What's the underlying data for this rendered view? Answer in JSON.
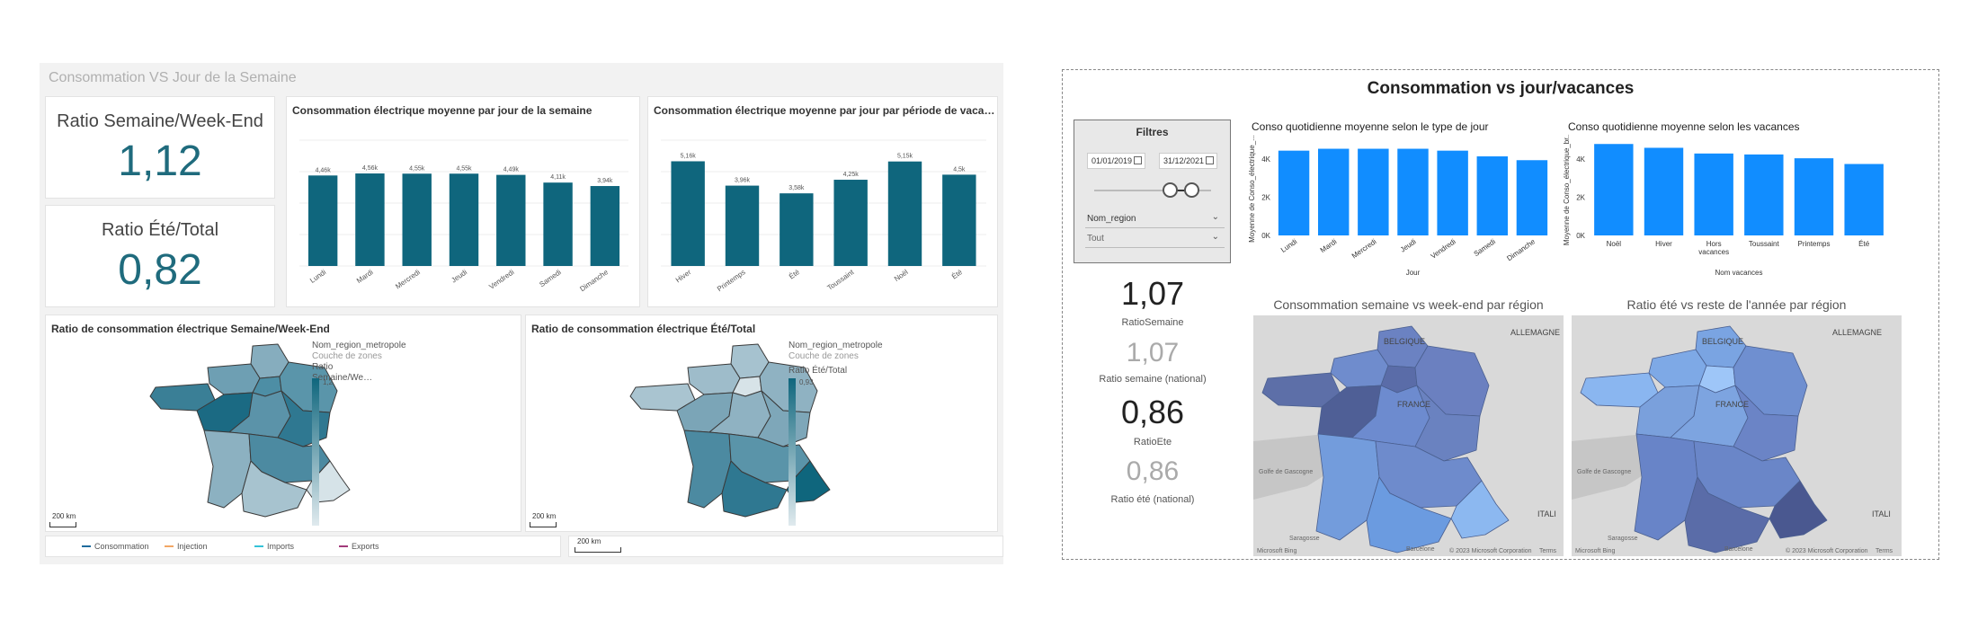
{
  "left": {
    "title": "Consommation VS Jour de la Semaine",
    "kpi1": {
      "label": "Ratio Semaine/Week-End",
      "value": "1,12"
    },
    "kpi2": {
      "label": "Ratio Été/Total",
      "value": "0,82"
    },
    "chart1_title": "Consommation électrique moyenne par jour de la semaine",
    "chart2_title": "Consommation électrique moyenne par jour par période de vacanc…",
    "map1": {
      "title": "Ratio de consommation électrique Semaine/Week-End",
      "legend_field": "Nom_region_metropole",
      "legend_sub": "Couche de zones",
      "legend_measure": "Ratio Semaine/We…",
      "legend_max": "1,2",
      "scale": "200 km"
    },
    "map2": {
      "title": "Ratio de consommation électrique Été/Total",
      "legend_field": "Nom_region_metropole",
      "legend_sub": "Couche de zones",
      "legend_measure": "Ratio Été/Total",
      "legend_max": "0,93",
      "scale": "200 km"
    },
    "bottom_legend": [
      {
        "label": "Consommation",
        "color": "#1f6b9d"
      },
      {
        "label": "Injection",
        "color": "#f2a766"
      },
      {
        "label": "Imports",
        "color": "#35c3d8"
      },
      {
        "label": "Exports",
        "color": "#a23a7a"
      }
    ],
    "bottom_scale": "200 km",
    "accent": "#0f667d"
  },
  "right": {
    "title": "Consommation vs jour/vacances",
    "filters": {
      "title": "Filtres",
      "date_from": "01/01/2019",
      "date_to": "31/12/2021",
      "region_label": "Nom_region",
      "region_value": "Tout"
    },
    "chart1_title": "Conso quotidienne moyenne selon le type de jour",
    "chart2_title": "Conso quotidienne moyenne selon les vacances",
    "kpis": [
      {
        "value": "1,07",
        "caption": "RatioSemaine",
        "muted": false
      },
      {
        "value": "1,07",
        "caption": "Ratio semaine (national)",
        "muted": true
      },
      {
        "value": "0,86",
        "caption": "RatioEte",
        "muted": false
      },
      {
        "value": "0,86",
        "caption": "Ratio été (national)",
        "muted": true
      }
    ],
    "map1_title": "Consommation semaine vs week-end par région",
    "map2_title": "Ratio été vs reste de l'année par région",
    "map_labels": {
      "belgique": "BELGIQUE",
      "allemagne": "ALLEMAGNE",
      "france": "FRANCE",
      "golfe": "Golfe de Gascogne",
      "italie": "ITALI",
      "saragosse": "Saragosse",
      "barcelone": "Barcelone",
      "copyright": "© 2023 Microsoft Corporation",
      "terms": "Terms",
      "bing": "Microsoft Bing"
    },
    "accent": "#118dff"
  },
  "chart_data": [
    {
      "type": "bar",
      "title": "Consommation électrique moyenne par jour de la semaine",
      "categories": [
        "Lundi",
        "Mardi",
        "Mercredi",
        "Jeudi",
        "Vendredi",
        "Samedi",
        "Dimanche"
      ],
      "values": [
        4.46,
        4.56,
        4.55,
        4.55,
        4.49,
        4.11,
        3.94
      ],
      "labels": [
        "4,46k",
        "4,56k",
        "4,55k",
        "4,55k",
        "4,49k",
        "4,11k",
        "3,94k"
      ],
      "ylim": [
        0,
        6.2
      ],
      "grid": true
    },
    {
      "type": "bar",
      "title": "Consommation électrique moyenne par jour par période de vacanc…",
      "categories": [
        "Hiver",
        "Printemps",
        "Été",
        "Toussaint",
        "Noël",
        "Été"
      ],
      "values": [
        5.16,
        3.96,
        3.58,
        4.25,
        5.15,
        4.5
      ],
      "labels": [
        "5,16k",
        "3,96k",
        "3,58k",
        "4,25k",
        "5,15k",
        "4,5k"
      ],
      "ylim": [
        0,
        6.2
      ],
      "grid": true
    },
    {
      "type": "bar",
      "title": "Conso quotidienne moyenne selon le type de jour",
      "xlabel": "Jour",
      "ylabel": "Moyenne de Conso_électrique_...",
      "categories": [
        "Lundi",
        "Mardi",
        "Mercredi",
        "Jeudi",
        "Vendredi",
        "Samedi",
        "Dimanche"
      ],
      "values": [
        4.45,
        4.55,
        4.55,
        4.55,
        4.45,
        4.15,
        3.95
      ],
      "yticks": [
        "0K",
        "2K",
        "4K"
      ],
      "ylim": [
        0,
        5
      ]
    },
    {
      "type": "bar",
      "title": "Conso quotidienne moyenne selon les vacances",
      "xlabel": "Nom vacances",
      "ylabel": "Moyenne de Conso_électrique_br...",
      "categories": [
        "Noël",
        "Hiver",
        "Hors vacances",
        "Toussaint",
        "Printemps",
        "Été"
      ],
      "values": [
        4.8,
        4.6,
        4.3,
        4.25,
        4.05,
        3.75
      ],
      "yticks": [
        "0K",
        "2K",
        "4K"
      ],
      "ylim": [
        0,
        5
      ]
    }
  ]
}
